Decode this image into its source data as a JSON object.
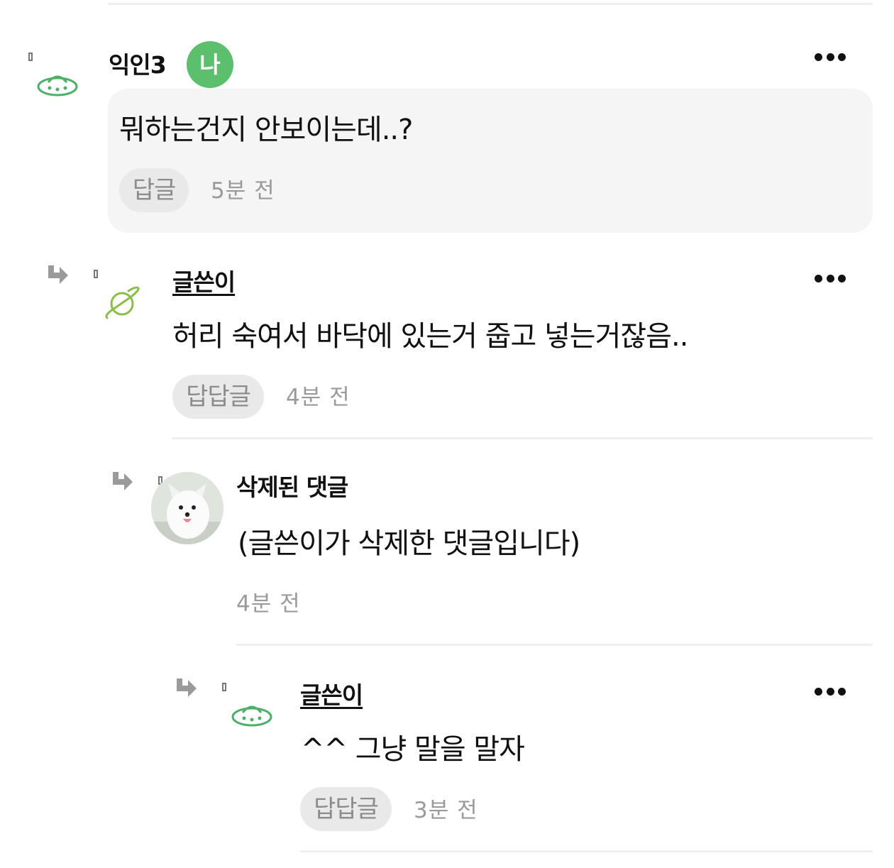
{
  "comments": [
    {
      "author": "익인3",
      "badge": "나",
      "avatar_icon": "ufo-icon",
      "text": "뭐하는건지 안보이는데..?",
      "reply_label": "답글",
      "time": "5분 전"
    },
    {
      "author": "글쓴이",
      "avatar_icon": "planet-icon",
      "text": "허리 숙여서 바닥에 있는거 줍고 넣는거잖음..",
      "reply_label": "답답글",
      "time": "4분 전"
    },
    {
      "author": "삭제된 댓글",
      "avatar_icon": "dog-photo-avatar",
      "text": "(글쓴이가 삭제한 댓글입니다)",
      "time": "4분 전"
    },
    {
      "author": "글쓴이",
      "avatar_icon": "ufo-icon",
      "text": "^^ 그냥 말을 말자",
      "reply_label": "답답글",
      "time": "3분 전"
    }
  ],
  "colors": {
    "badge_green": "#5bbf6e",
    "ufo_green": "#4caf6a",
    "planet_green": "#8bbd4a",
    "pill_bg": "#e9e9e9",
    "bubble_bg": "#f5f5f5"
  }
}
